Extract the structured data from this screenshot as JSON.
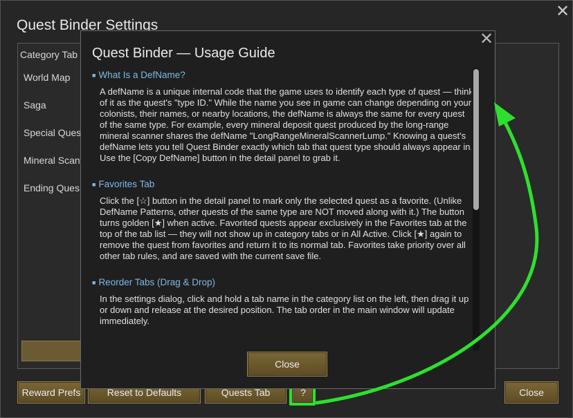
{
  "settings": {
    "title": "Quest Binder Settings",
    "category_tabs_label": "Category Tab",
    "categories": [
      "World Map",
      "Saga",
      "Special Ques",
      "Mineral Scan",
      "Ending Ques"
    ],
    "bottom_buttons": {
      "reward_prefs": "Reward Prefs",
      "reset_defaults": "Reset to Defaults",
      "quests_tab": "Quests Tab",
      "help": "?",
      "close": "Close"
    },
    "close_icon": "close-icon"
  },
  "guide": {
    "title": "Quest Binder — Usage Guide",
    "close_icon": "close-icon",
    "sections": [
      {
        "heading": "What Is a DefName?",
        "text": "A defName is a unique internal code that the game uses to identify each type of quest — think of it as the quest's \"type ID.\" While the name you see in game can change depending on your colonists, their names, or nearby locations, the defName is always the same for every quest of the same type. For example, every mineral deposit quest produced by the long-range mineral scanner shares the defName \"LongRangeMineralScannerLump.\" Knowing a quest's defName lets you tell Quest Binder exactly which tab that quest type should always appear in. Use the [Copy DefName] button in the detail panel to grab it."
      },
      {
        "heading": "Favorites Tab",
        "text": "Click the [☆] button in the detail panel to mark only the selected quest as a favorite. (Unlike DefName Patterns, other quests of the same type are NOT moved along with it.) The button turns golden [★] when active. Favorited quests appear exclusively in the Favorites tab at the top of the tab list — they will not show up in category tabs or in All Active. Click [★] again to remove the quest from favorites and return it to its normal tab. Favorites take priority over all other tab rules, and are saved with the current save file."
      },
      {
        "heading": "Reorder Tabs (Drag & Drop)",
        "text": "In the settings dialog, click and hold a tab name in the category list on the left, then drag it up or down and release at the desired position. The tab order in the main window will update immediately."
      }
    ],
    "close_button": "Close"
  },
  "colors": {
    "accent_heading": "#7fb8e4",
    "button_gold": "#6b5a32",
    "highlight_green": "#2ee02e"
  }
}
